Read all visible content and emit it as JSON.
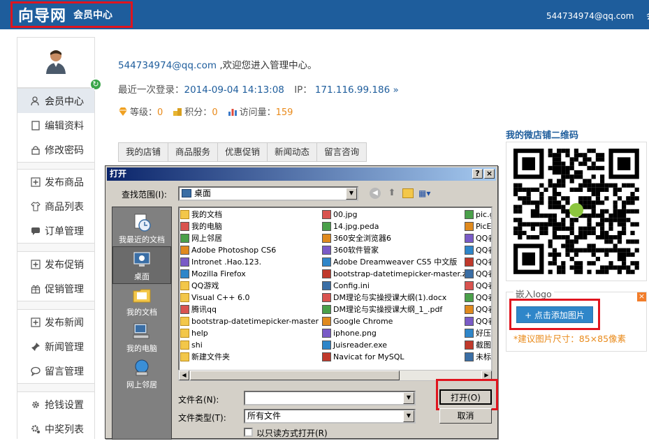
{
  "header": {
    "logo": "向导网",
    "subtitle": "会员中心",
    "user_email": "544734974@qq.com",
    "user_tail": "会"
  },
  "sidebar": {
    "groups": [
      {
        "items": [
          {
            "label": "会员中心",
            "icon": "user-icon"
          },
          {
            "label": "编辑资料",
            "icon": "profile-icon"
          },
          {
            "label": "修改密码",
            "icon": "lock-icon"
          }
        ]
      },
      {
        "items": [
          {
            "label": "发布商品",
            "icon": "plus-icon"
          },
          {
            "label": "商品列表",
            "icon": "tshirt-icon"
          },
          {
            "label": "订单管理",
            "icon": "chat-icon"
          }
        ]
      },
      {
        "items": [
          {
            "label": "发布促销",
            "icon": "plus-icon"
          },
          {
            "label": "促销管理",
            "icon": "gift-icon"
          }
        ]
      },
      {
        "items": [
          {
            "label": "发布新闻",
            "icon": "plus-icon"
          },
          {
            "label": "新闻管理",
            "icon": "pin-icon"
          },
          {
            "label": "留言管理",
            "icon": "comment-icon"
          }
        ]
      },
      {
        "items": [
          {
            "label": "抢钱设置",
            "icon": "gear-icon"
          },
          {
            "label": "中奖列表",
            "icon": "gear-icon"
          }
        ]
      }
    ]
  },
  "welcome": {
    "email": "544734974@qq.com",
    "text": " ,欢迎您进入管理中心。"
  },
  "last_login": {
    "label": "最近一次登录：",
    "time": "2014-09-04 14:13:08",
    "ip_label": "IP：",
    "ip": "171.116.99.186 »"
  },
  "stats": [
    {
      "label": "等级：",
      "value": "0"
    },
    {
      "label": "积分：",
      "value": "0"
    },
    {
      "label": "访问量：",
      "value": "159"
    }
  ],
  "tabs": [
    "我的店铺",
    "商品服务",
    "优惠促销",
    "新闻动态",
    "留言咨询"
  ],
  "qr": {
    "title": "我的微店铺二维码"
  },
  "embed": {
    "label": "嵌入logo",
    "button": "+ 点击添加图片",
    "suggest": "*建议图片尺寸：85×85像素",
    "close": "×"
  },
  "dialog": {
    "title": "打开",
    "help": "?",
    "close": "×",
    "lookin_label": "查找范围(I):",
    "lookin_value": "桌面",
    "places": [
      "我最近的文档",
      "桌面",
      "我的文档",
      "我的电脑",
      "网上邻居"
    ],
    "col1": [
      "我的文档",
      "我的电脑",
      "网上邻居",
      "Adobe Photoshop CS6",
      "Intronet .Hao.123.",
      "Mozilla Firefox",
      "QQ游戏",
      "Visual C++ 6.0",
      "腾讯qq",
      "bootstrap-datetimepicker-master",
      "help",
      "shi",
      "新建文件夹"
    ],
    "col2": [
      "00.jpg",
      "14.jpg.peda",
      "360安全浏览器6",
      "360软件管家",
      "Adobe Dreamweaver CS5 中文版",
      "bootstrap-datetimepicker-master.zip",
      "Config.ini",
      "DM理论与实操授课大纲(1).docx",
      "DM理论与实操授课大纲_1_.pdf",
      "Google Chrome",
      "iphone.png",
      "Juisreader.exe",
      "Navicat for MySQL"
    ],
    "col3": [
      "pic.g",
      "PicEc",
      "QQ者",
      "QQ者",
      "QQ者",
      "QQ者",
      "QQ者",
      "QQ者",
      "QQ者",
      "QQ者",
      "好压",
      "截图",
      "未标"
    ],
    "filename_label": "文件名(N):",
    "filename_value": "",
    "filetype_label": "文件类型(T):",
    "filetype_value": "所有文件",
    "readonly_label": "以只读方式打开(R)",
    "open_button": "打开(O)",
    "cancel_button": "取消"
  }
}
